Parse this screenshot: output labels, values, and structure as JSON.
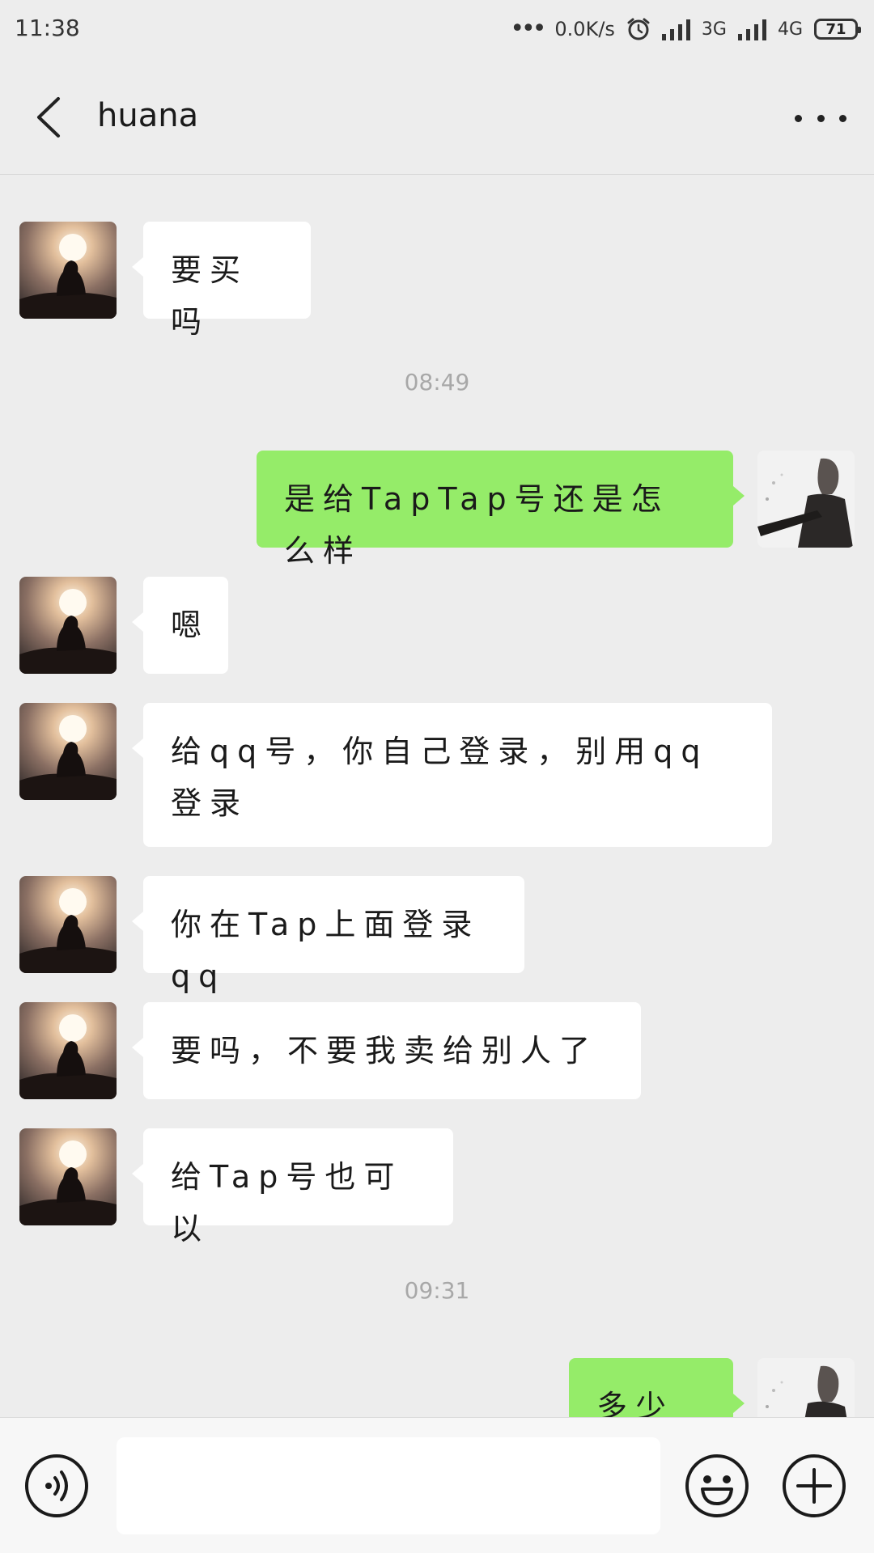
{
  "status_bar": {
    "time": "11:38",
    "dots": "•••",
    "speed": "0.0K/s",
    "network1": "3G",
    "network2": "4G",
    "battery": "71",
    "icons": [
      "alarm-clock-icon",
      "signal-icon",
      "battery-icon"
    ]
  },
  "header": {
    "title": "huana",
    "back_icon": "chevron-left-icon",
    "more_icon": "more-dots-icon"
  },
  "messages": [
    {
      "side": "in",
      "text": "要买吗"
    },
    {
      "type": "time",
      "text": "08:49"
    },
    {
      "side": "out",
      "text": "是给TapTap号还是怎么样"
    },
    {
      "side": "in",
      "text": "嗯"
    },
    {
      "side": "in",
      "text": "给qq号，你自己登录，别用qq登录"
    },
    {
      "side": "in",
      "text": "你在Tap上面登录qq"
    },
    {
      "side": "in",
      "text": "要吗，不要我卖给别人了"
    },
    {
      "side": "in",
      "text": "给Tap号也可以"
    },
    {
      "type": "time",
      "text": "09:31"
    },
    {
      "side": "out",
      "text": "多少钱"
    }
  ],
  "input_bar": {
    "value": "",
    "placeholder": "",
    "voice_icon": "voice-icon",
    "emoji_icon": "emoji-icon",
    "plus_icon": "plus-icon"
  },
  "colors": {
    "background": "#ededed",
    "incoming_bubble": "#ffffff",
    "outgoing_bubble": "#95ec69",
    "timestamp": "#a8a8a8"
  }
}
